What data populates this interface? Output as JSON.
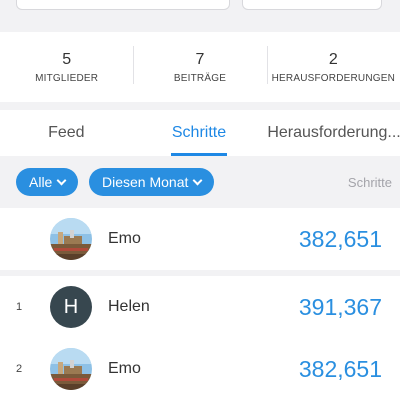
{
  "stats": [
    {
      "value": "5",
      "label": "MITGLIEDER"
    },
    {
      "value": "7",
      "label": "BEITRÄGE"
    },
    {
      "value": "2",
      "label": "HERAUSFORDERUNGEN"
    }
  ],
  "tabs": [
    {
      "label": "Feed",
      "active": false
    },
    {
      "label": "Schritte",
      "active": true
    },
    {
      "label": "Herausforderung..."
    }
  ],
  "filters": {
    "scope": "Alle",
    "period": "Diesen Monat",
    "metric": "Schritte"
  },
  "me_row": {
    "rank": "",
    "name": "Emo",
    "steps": "382,651"
  },
  "leaderboard": [
    {
      "rank": "1",
      "name": "Helen",
      "initial": "H",
      "steps": "391,367"
    },
    {
      "rank": "2",
      "name": "Emo",
      "steps": "382,651"
    }
  ],
  "colors": {
    "accent": "#1e88e5",
    "chip": "#2a8fe0",
    "avatar_letter_bg": "#37474f"
  }
}
